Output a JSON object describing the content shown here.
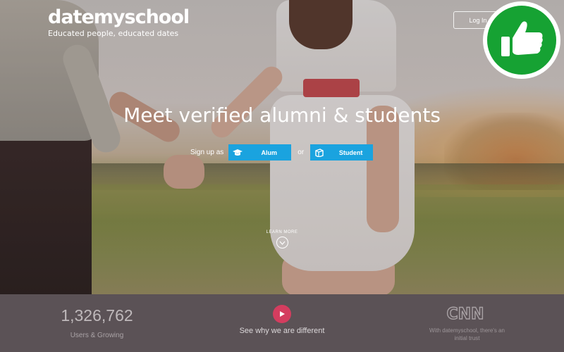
{
  "header": {
    "brand_name": "datemyschool",
    "brand_tagline": "Educated people, educated dates",
    "login_label": "Log In"
  },
  "badge": {
    "icon": "thumbs-up-icon",
    "color": "#16a233"
  },
  "hero": {
    "headline": "Meet verified alumni & students",
    "signup_label": "Sign up as",
    "or_label": "or",
    "buttons": [
      {
        "label": "Alum",
        "icon": "graduation-cap-icon"
      },
      {
        "label": "Student",
        "icon": "book-icon"
      }
    ],
    "learn_more_label": "LEARN MORE",
    "accent_color": "#1aa3df"
  },
  "footer": {
    "user_count": "1,326,762",
    "user_count_label": "Users & Growing",
    "video_label": "See why we are different",
    "press_logo": "CNN",
    "press_quote": "With datemyschool, there's an initial trust",
    "play_color": "#d43d5f"
  }
}
